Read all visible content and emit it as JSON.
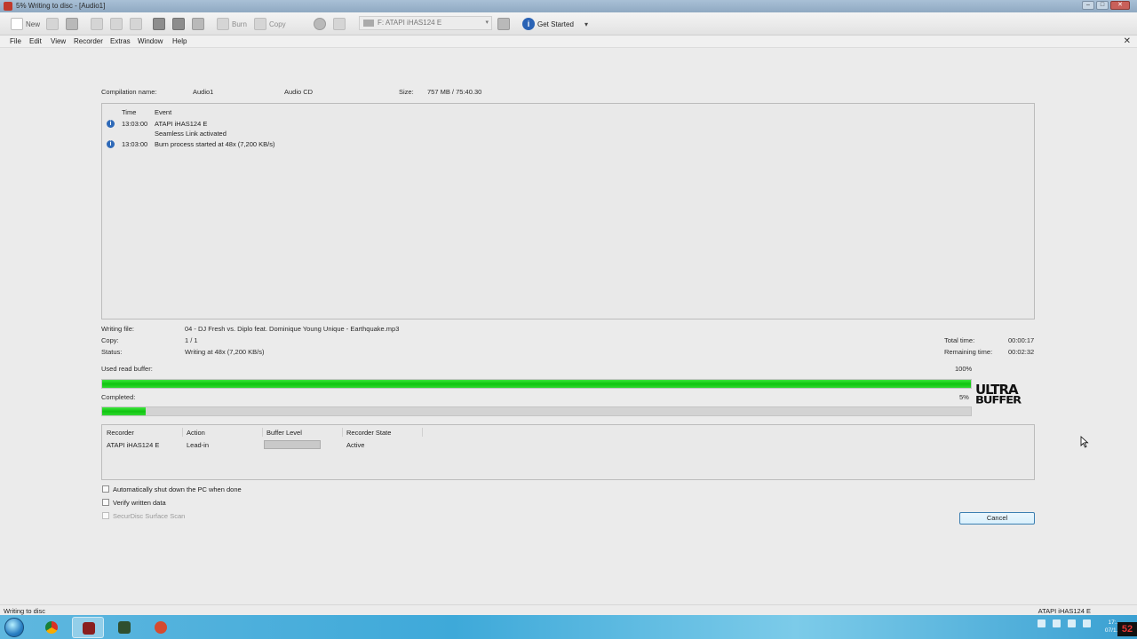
{
  "window": {
    "title": "5% Writing to disc - [Audio1]"
  },
  "toolbar": {
    "new_label": "New",
    "burn_label": "Burn",
    "copy_label": "Copy",
    "drive_label": "F: ATAPI iHAS124  E",
    "get_started_label": "Get Started"
  },
  "menu": [
    "File",
    "Edit",
    "View",
    "Recorder",
    "Extras",
    "Window",
    "Help"
  ],
  "compilation": {
    "name_label": "Compilation name:",
    "name_value": "Audio1",
    "type_value": "Audio CD",
    "size_label": "Size:",
    "size_value": "757 MB  /  75:40.30"
  },
  "log": {
    "headers": {
      "time": "Time",
      "event": "Event"
    },
    "rows": [
      {
        "time": "13:03:00",
        "event": "ATAPI iHAS124  E",
        "icon": "info-icon"
      },
      {
        "time": "",
        "event": "Seamless Link activated",
        "icon": ""
      },
      {
        "time": "13:03:00",
        "event": "Burn process started at 48x (7,200 KB/s)",
        "icon": "info-icon"
      }
    ]
  },
  "progress": {
    "writing_file_label": "Writing file:",
    "writing_file_value": "04 - DJ Fresh vs. Diplo feat. Dominique Young Unique - Earthquake.mp3",
    "copy_label": "Copy:",
    "copy_value": "1 / 1",
    "status_label": "Status:",
    "status_value": "Writing at 48x (7,200 KB/s)",
    "total_time_label": "Total time:",
    "total_time_value": "00:00:17",
    "remaining_time_label": "Remaining time:",
    "remaining_time_value": "00:02:32",
    "buffer_label": "Used read buffer:",
    "buffer_percent_text": "100%",
    "buffer_fraction": 1.0,
    "completed_label": "Completed:",
    "completed_percent_text": "5%",
    "completed_fraction": 0.05,
    "logo_line1": "ULTRA",
    "logo_line2": "BUFFER"
  },
  "recorders": {
    "headers": {
      "recorder": "Recorder",
      "action": "Action",
      "buffer_level": "Buffer Level",
      "state": "Recorder State"
    },
    "rows": [
      {
        "recorder": "ATAPI iHAS124  E",
        "action": "Lead-in",
        "buffer_level": 0,
        "state": "Active"
      }
    ]
  },
  "options": {
    "shutdown_label": "Automatically shut down the PC when done",
    "verify_label": "Verify written data",
    "securdisc_label": "SecurDisc Surface Scan"
  },
  "buttons": {
    "cancel_label": "Cancel"
  },
  "statusbar": {
    "left": "Writing to disc",
    "right": "ATAPI   iHAS124   E"
  },
  "taskbar": {
    "clock_line1": "17:...",
    "clock_line2": "07/1...",
    "badge": "52"
  },
  "colors": {
    "progress_green": "#1fd01f",
    "accent_blue": "#3c7fb1"
  }
}
